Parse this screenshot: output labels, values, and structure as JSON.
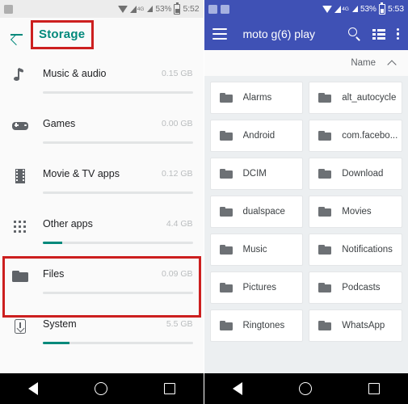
{
  "left_screen": {
    "status_bar": {
      "battery_percent": "53%",
      "time": "5:52",
      "network": "4G"
    },
    "app_bar": {
      "back_label": "back-arrow",
      "title": "Storage"
    },
    "highlight_color": "#cc1f1f",
    "accent_color": "#00897b",
    "storage_items": [
      {
        "icon": "music-note-icon",
        "name": "Music & audio",
        "size": "0.15 GB",
        "progress": 0
      },
      {
        "icon": "gamepad-icon",
        "name": "Games",
        "size": "0.00 GB",
        "progress": 0
      },
      {
        "icon": "film-strip-icon",
        "name": "Movie & TV apps",
        "size": "0.12 GB",
        "progress": 0
      },
      {
        "icon": "app-grid-icon",
        "name": "Other apps",
        "size": "4.4 GB",
        "progress": 13
      },
      {
        "icon": "folder-icon",
        "name": "Files",
        "size": "0.09 GB",
        "progress": 0
      },
      {
        "icon": "system-icon",
        "name": "System",
        "size": "5.5 GB",
        "progress": 18
      }
    ],
    "nav_bar": {
      "back": "back-triangle-icon",
      "home": "home-circle-icon",
      "recents": "recents-square-icon"
    }
  },
  "right_screen": {
    "status_bar": {
      "battery_percent": "53%",
      "time": "5:53",
      "network": "4G"
    },
    "app_bar": {
      "menu": "hamburger-icon",
      "title": "moto g(6) play",
      "search": "search-icon",
      "view_toggle": "list-view-icon",
      "overflow": "more-vertical-icon",
      "background_color": "#3f51b5"
    },
    "sort_bar": {
      "label": "Name",
      "direction": "ascending"
    },
    "folders": [
      "Alarms",
      "alt_autocycle",
      "Android",
      "com.facebo...",
      "DCIM",
      "Download",
      "dualspace",
      "Movies",
      "Music",
      "Notifications",
      "Pictures",
      "Podcasts",
      "Ringtones",
      "WhatsApp"
    ],
    "nav_bar": {
      "back": "back-triangle-icon",
      "home": "home-circle-icon",
      "recents": "recents-square-icon"
    }
  }
}
